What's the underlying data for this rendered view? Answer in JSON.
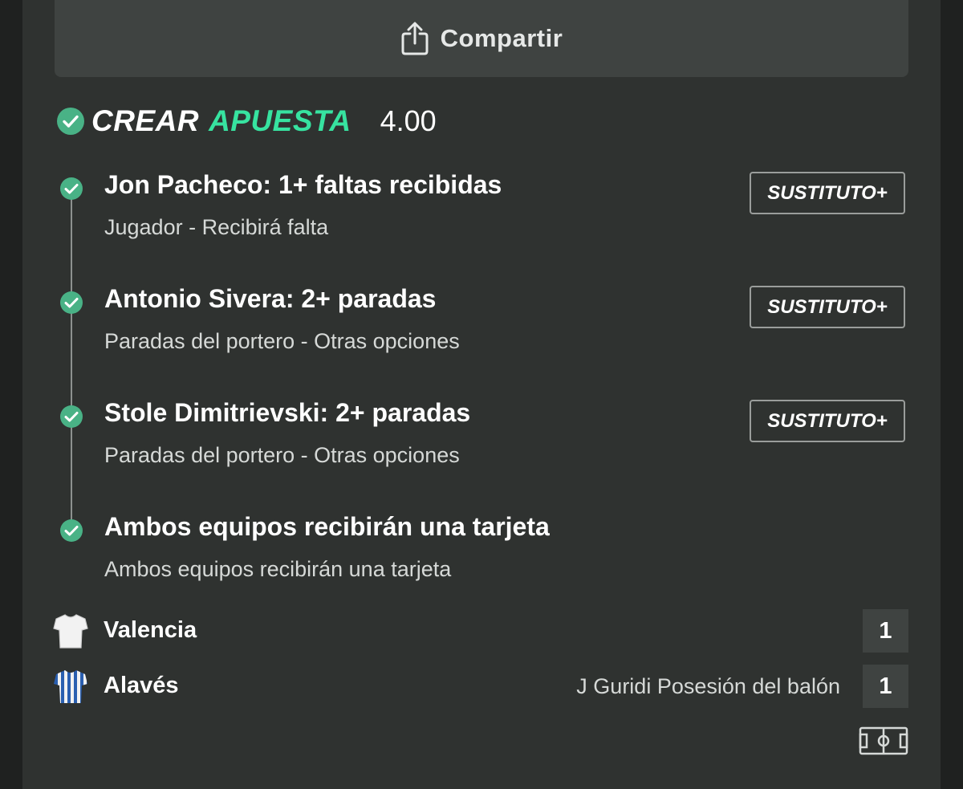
{
  "share": {
    "label": "Compartir",
    "icon": "share-icon"
  },
  "bet_builder": {
    "title_part1": "CREAR",
    "title_part2": "APUESTA",
    "odds": "4.00",
    "accent_color": "#37e3a0"
  },
  "selections": [
    {
      "title": "Jon Pacheco: 1+ faltas recibidas",
      "subtitle": "Jugador - Recibirá falta",
      "substitute_label": "SUSTITUTO+"
    },
    {
      "title": "Antonio Sivera: 2+ paradas",
      "subtitle": "Paradas del portero - Otras opciones",
      "substitute_label": "SUSTITUTO+"
    },
    {
      "title": "Stole Dimitrievski: 2+ paradas",
      "subtitle": "Paradas del portero - Otras opciones",
      "substitute_label": "SUSTITUTO+"
    },
    {
      "title": "Ambos equipos recibirán una tarjeta",
      "subtitle": "Ambos equipos recibirán una tarjeta"
    }
  ],
  "match": {
    "home": {
      "name": "Valencia",
      "score": "1",
      "info": ""
    },
    "away": {
      "name": "Alavés",
      "score": "1",
      "info": "J Guridi Posesión del balón"
    }
  }
}
